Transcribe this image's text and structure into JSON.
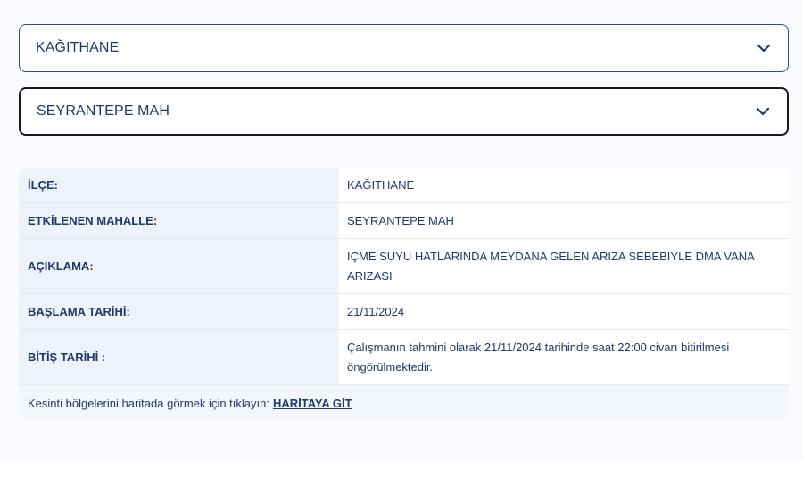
{
  "district_select": {
    "value": "KAĞITHANE",
    "icon": "chevron-down-icon"
  },
  "neighborhood_select": {
    "value": "SEYRANTEPE MAH",
    "icon": "chevron-down-icon"
  },
  "info_table": {
    "rows": [
      {
        "label": "İLÇE:",
        "value": "KAĞITHANE"
      },
      {
        "label": "ETKİLENEN MAHALLE:",
        "value": "SEYRANTEPE MAH"
      },
      {
        "label": "AÇIKLAMA:",
        "value": "İÇME SUYU HATLARINDA MEYDANA GELEN ARIZA SEBEBIYLE DMA VANA ARIZASI"
      },
      {
        "label": "BAŞLAMA TARİHİ:",
        "value": "21/11/2024"
      },
      {
        "label": "BİTİŞ TARİHİ :",
        "value": "Çalışmanın tahmini olarak 21/11/2024 tarihinde saat 22:00 civarı bitirilmesi öngörülmektedir."
      }
    ]
  },
  "footer": {
    "text": "Kesinti bölgelerini haritada görmek için tıklayın:",
    "link_label": "HARİTAYA GİT"
  },
  "colors": {
    "text": "#1f3a68",
    "label_bg": "#eef3fa",
    "select_border": "#2b4f86"
  }
}
